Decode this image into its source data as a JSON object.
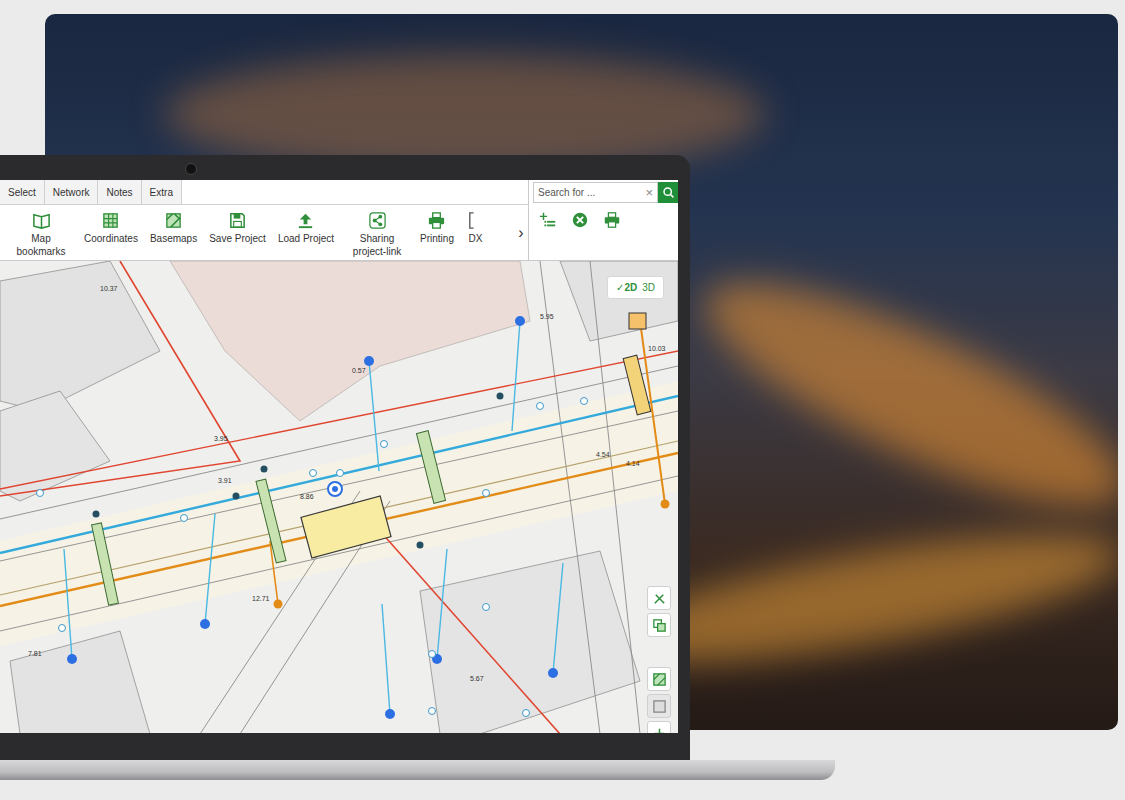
{
  "tabs": [
    {
      "label": "Select",
      "selected": false
    },
    {
      "label": "Network",
      "selected": false
    },
    {
      "label": "Notes",
      "selected": false
    },
    {
      "label": "Extra",
      "selected": false
    }
  ],
  "toolbar": [
    "Map bookmarks",
    "Coordinates",
    "Basemaps",
    "Save Project",
    "Load Project",
    "Sharing project-link",
    "Printing",
    "DX"
  ],
  "scroll_arrow": "›",
  "search": {
    "placeholder": "Search for ...",
    "clear": "×"
  },
  "view_toggle": {
    "check": "✓",
    "options": [
      {
        "label": "2D",
        "selected": true
      },
      {
        "label": "3D",
        "selected": false
      }
    ]
  },
  "map": {
    "labels": [
      "10.37",
      "0.57",
      "3.95",
      "8.86",
      "12.71",
      "7.81",
      "4.14",
      "4.54",
      "10.03",
      "5.95",
      "3.91",
      "5.67"
    ]
  }
}
